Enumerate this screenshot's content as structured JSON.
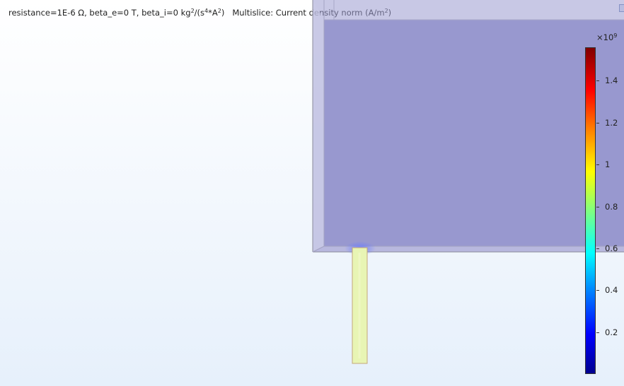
{
  "header": {
    "parameters": "resistance=1E-6 Ω, beta_e=0 T, beta_i=0 kg",
    "param_exp_1": "2",
    "param_mid": "/(s",
    "param_exp_2": "4",
    "param_times": "*A",
    "param_exp_3": "2",
    "param_close": ")",
    "plot_title": "Multislice: Current density norm (A/m",
    "title_exp": "2",
    "title_close": ")"
  },
  "colorbar": {
    "multiplier": "×10",
    "multiplier_exp": "9",
    "ticks": [
      "1.4",
      "1.2",
      "1",
      "0.8",
      "0.6",
      "0.4",
      "0.2"
    ],
    "tick_values": [
      1.4,
      1.2,
      1.0,
      0.8,
      0.6,
      0.4,
      0.2
    ],
    "range": [
      0,
      1.56
    ],
    "colormap": "rainbow"
  },
  "colors": {
    "box_fill": "#9b9bd0",
    "conductor_fill": "#e8f5b4",
    "background_top": "#ffffff",
    "background_bottom": "#e6f0fb"
  }
}
